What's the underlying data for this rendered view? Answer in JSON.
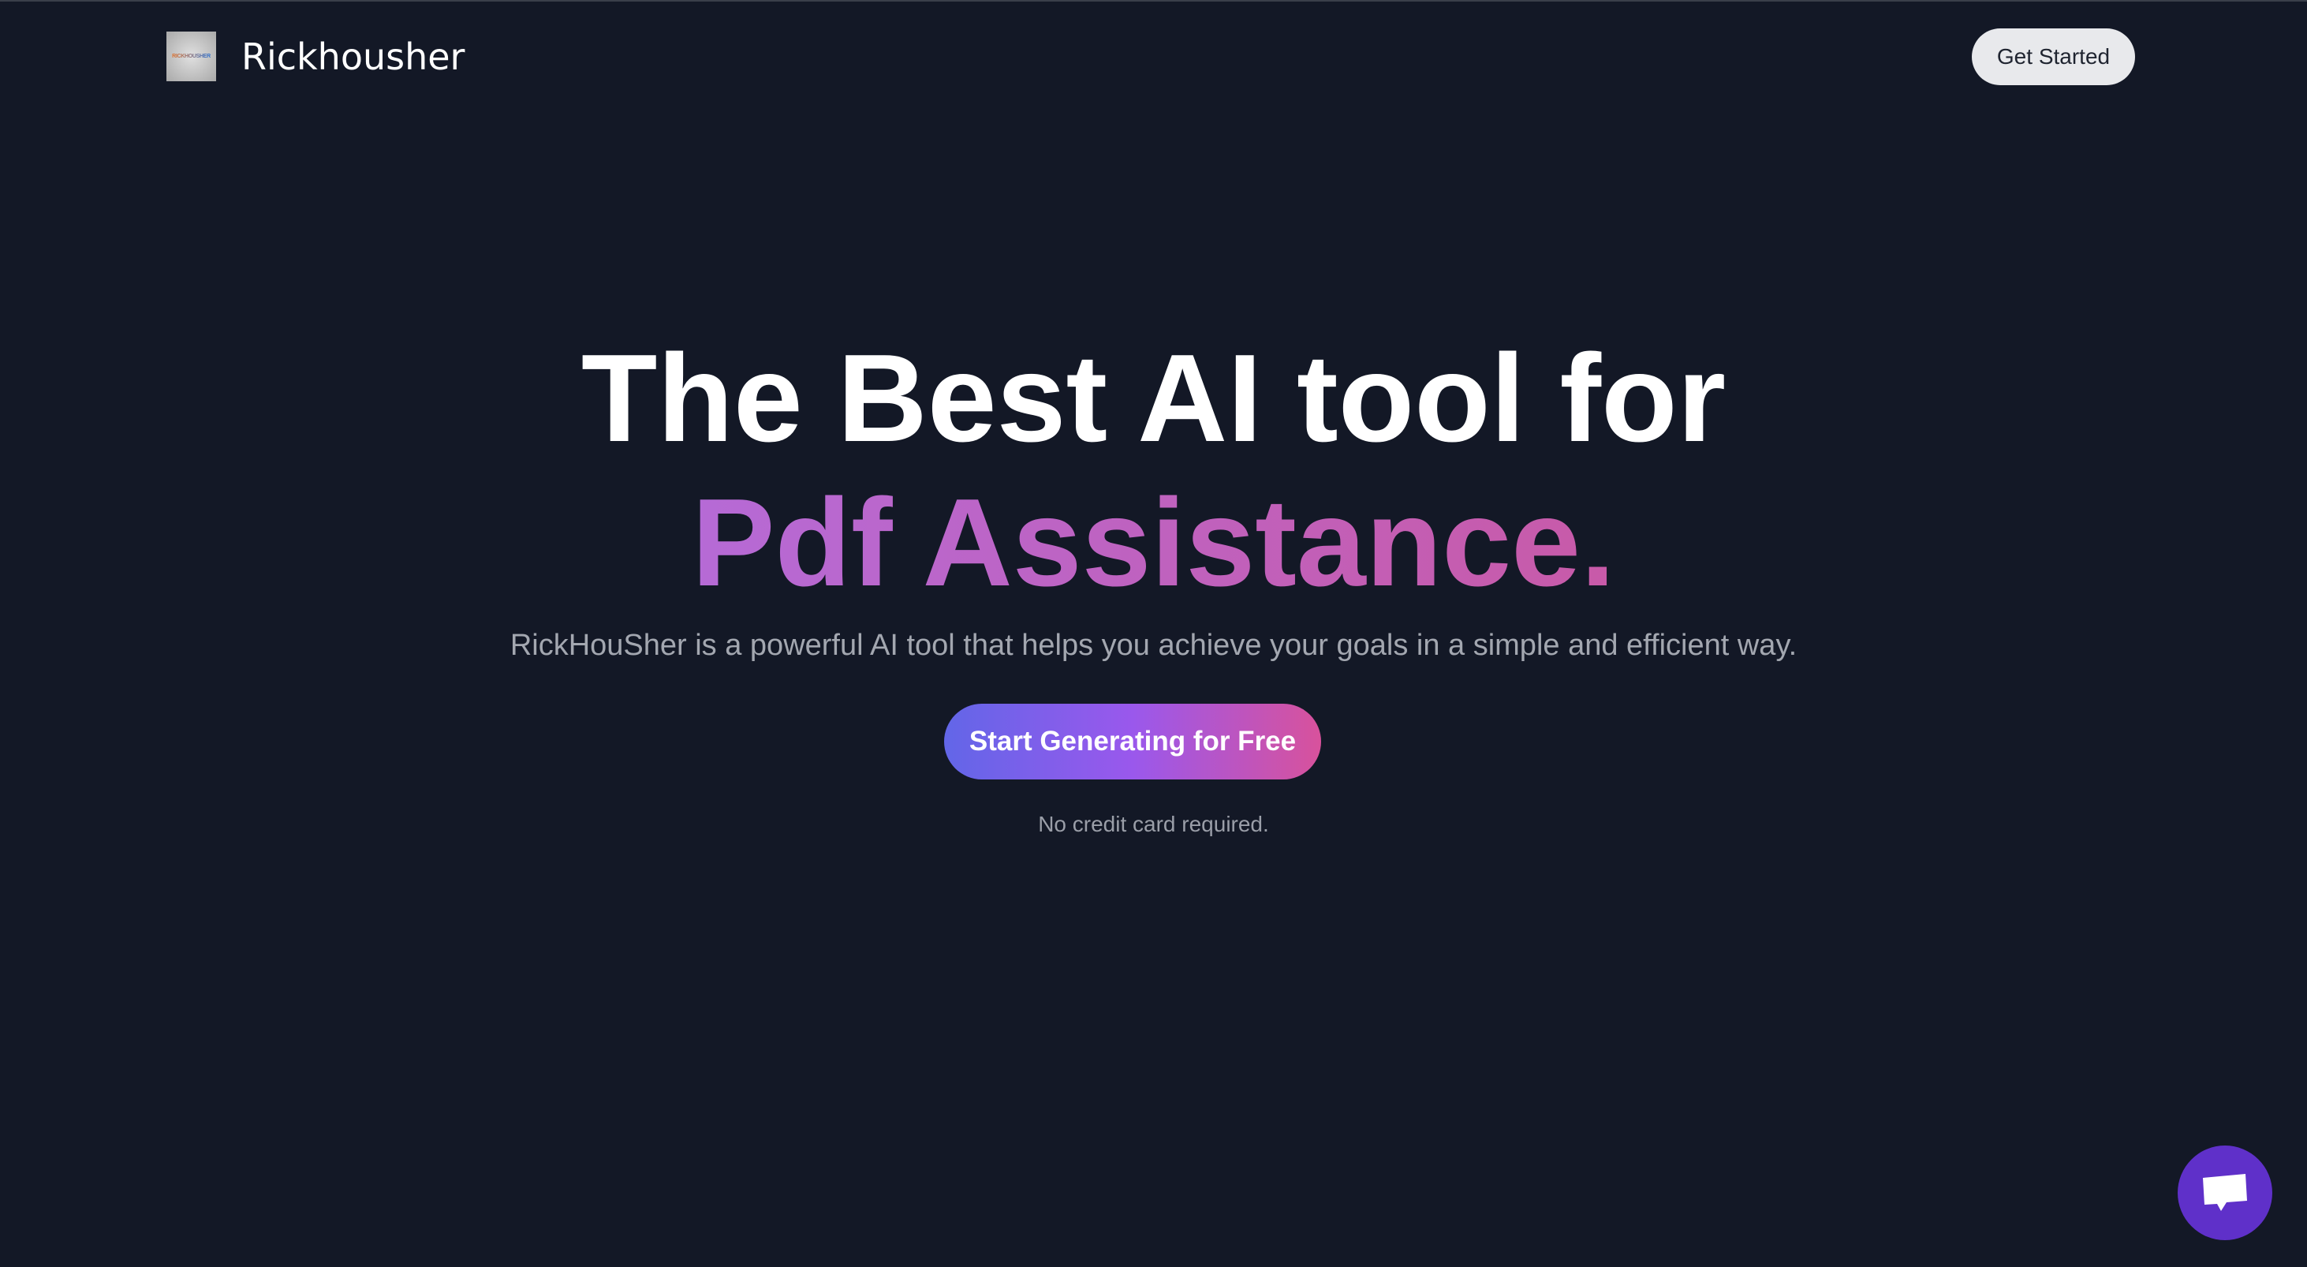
{
  "header": {
    "logo_text": "RICKHOUSHER",
    "brand": "Rickhousher",
    "get_started": "Get Started"
  },
  "hero": {
    "title_line1": "The Best AI tool for",
    "title_line2": "Pdf Assistance.",
    "subtitle": "RickHouSher is a powerful AI tool that helps you achieve your goals in a simple and efficient way.",
    "cta": "Start Generating for Free",
    "note": "No credit card required."
  },
  "chat": {
    "icon": "chat-bubble-icon"
  },
  "colors": {
    "background": "#131826",
    "accent": "#5f30c9"
  }
}
